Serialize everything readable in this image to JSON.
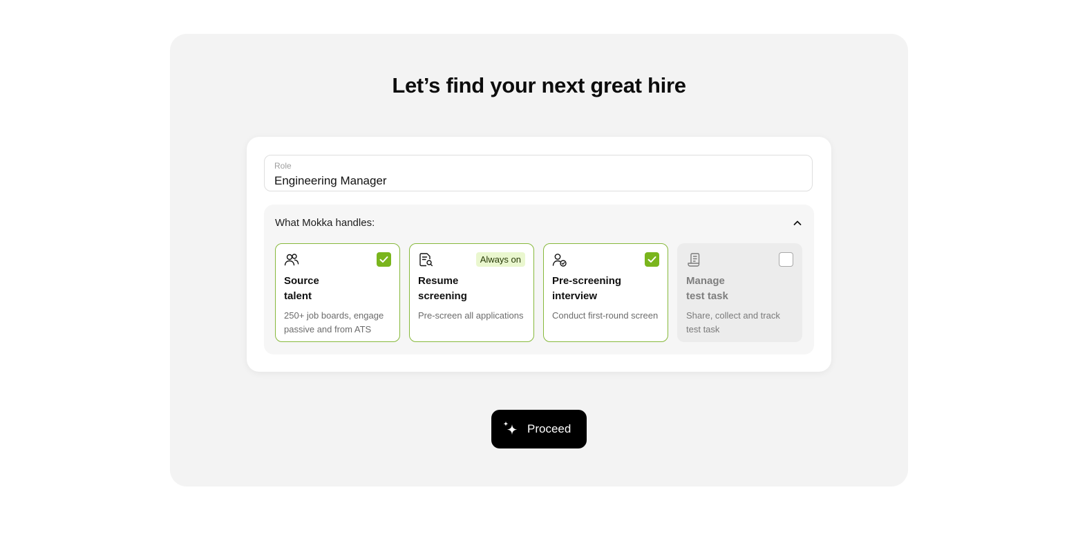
{
  "heading": "Let’s find your next great hire",
  "role": {
    "label": "Role",
    "value": "Engineering Manager"
  },
  "handles": {
    "title": "What Mokka handles:",
    "collapse_icon": "chevron-up-icon",
    "cards": [
      {
        "icon": "users-icon",
        "title_line1": "Source",
        "title_line2": "talent",
        "description": "250+ job boards, engage passive and from ATS",
        "state": "checked"
      },
      {
        "icon": "document-search-icon",
        "title_line1": "Resume",
        "title_line2": "screening",
        "description": "Pre-screen all applications",
        "state": "always-on",
        "badge": "Always on"
      },
      {
        "icon": "user-check-icon",
        "title_line1": "Pre-screening",
        "title_line2": "interview",
        "description": "Conduct first-round screen",
        "state": "checked"
      },
      {
        "icon": "test-task-icon",
        "title_line1": "Manage",
        "title_line2": "test task",
        "description": "Share, collect and track test task",
        "state": "unchecked"
      }
    ]
  },
  "proceed": {
    "label": "Proceed",
    "icon": "sparkle-icon"
  },
  "colors": {
    "accent_green": "#7ab51d",
    "card_border": "#86b83a",
    "badge_bg": "#eaf7cf",
    "page_bg": "#f3f3f3",
    "button_bg": "#000000"
  }
}
